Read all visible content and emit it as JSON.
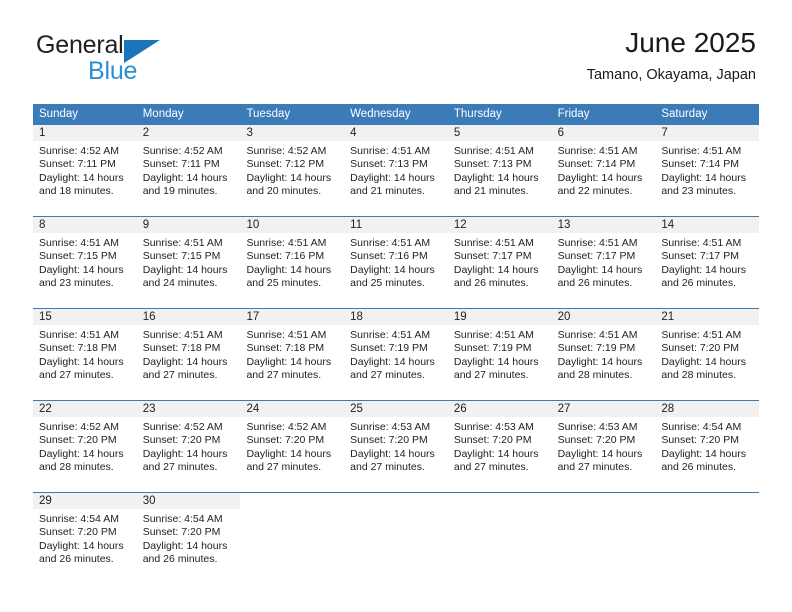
{
  "brand": {
    "name_top": "General",
    "name_bottom": "Blue",
    "accent_color": "#1b75bb",
    "accent_color_light": "#2b8fd4"
  },
  "header": {
    "title": "June 2025",
    "location": "Tamano, Okayama, Japan"
  },
  "theme": {
    "header_row_bg": "#3b7cb8",
    "day_number_bg": "#f1f1f1",
    "text_color": "#222222"
  },
  "calendar": {
    "weekdays": [
      "Sunday",
      "Monday",
      "Tuesday",
      "Wednesday",
      "Thursday",
      "Friday",
      "Saturday"
    ],
    "weeks": [
      [
        {
          "day": "1",
          "sunrise": "Sunrise: 4:52 AM",
          "sunset": "Sunset: 7:11 PM",
          "daylight_1": "Daylight: 14 hours",
          "daylight_2": "and 18 minutes."
        },
        {
          "day": "2",
          "sunrise": "Sunrise: 4:52 AM",
          "sunset": "Sunset: 7:11 PM",
          "daylight_1": "Daylight: 14 hours",
          "daylight_2": "and 19 minutes."
        },
        {
          "day": "3",
          "sunrise": "Sunrise: 4:52 AM",
          "sunset": "Sunset: 7:12 PM",
          "daylight_1": "Daylight: 14 hours",
          "daylight_2": "and 20 minutes."
        },
        {
          "day": "4",
          "sunrise": "Sunrise: 4:51 AM",
          "sunset": "Sunset: 7:13 PM",
          "daylight_1": "Daylight: 14 hours",
          "daylight_2": "and 21 minutes."
        },
        {
          "day": "5",
          "sunrise": "Sunrise: 4:51 AM",
          "sunset": "Sunset: 7:13 PM",
          "daylight_1": "Daylight: 14 hours",
          "daylight_2": "and 21 minutes."
        },
        {
          "day": "6",
          "sunrise": "Sunrise: 4:51 AM",
          "sunset": "Sunset: 7:14 PM",
          "daylight_1": "Daylight: 14 hours",
          "daylight_2": "and 22 minutes."
        },
        {
          "day": "7",
          "sunrise": "Sunrise: 4:51 AM",
          "sunset": "Sunset: 7:14 PM",
          "daylight_1": "Daylight: 14 hours",
          "daylight_2": "and 23 minutes."
        }
      ],
      [
        {
          "day": "8",
          "sunrise": "Sunrise: 4:51 AM",
          "sunset": "Sunset: 7:15 PM",
          "daylight_1": "Daylight: 14 hours",
          "daylight_2": "and 23 minutes."
        },
        {
          "day": "9",
          "sunrise": "Sunrise: 4:51 AM",
          "sunset": "Sunset: 7:15 PM",
          "daylight_1": "Daylight: 14 hours",
          "daylight_2": "and 24 minutes."
        },
        {
          "day": "10",
          "sunrise": "Sunrise: 4:51 AM",
          "sunset": "Sunset: 7:16 PM",
          "daylight_1": "Daylight: 14 hours",
          "daylight_2": "and 25 minutes."
        },
        {
          "day": "11",
          "sunrise": "Sunrise: 4:51 AM",
          "sunset": "Sunset: 7:16 PM",
          "daylight_1": "Daylight: 14 hours",
          "daylight_2": "and 25 minutes."
        },
        {
          "day": "12",
          "sunrise": "Sunrise: 4:51 AM",
          "sunset": "Sunset: 7:17 PM",
          "daylight_1": "Daylight: 14 hours",
          "daylight_2": "and 26 minutes."
        },
        {
          "day": "13",
          "sunrise": "Sunrise: 4:51 AM",
          "sunset": "Sunset: 7:17 PM",
          "daylight_1": "Daylight: 14 hours",
          "daylight_2": "and 26 minutes."
        },
        {
          "day": "14",
          "sunrise": "Sunrise: 4:51 AM",
          "sunset": "Sunset: 7:17 PM",
          "daylight_1": "Daylight: 14 hours",
          "daylight_2": "and 26 minutes."
        }
      ],
      [
        {
          "day": "15",
          "sunrise": "Sunrise: 4:51 AM",
          "sunset": "Sunset: 7:18 PM",
          "daylight_1": "Daylight: 14 hours",
          "daylight_2": "and 27 minutes."
        },
        {
          "day": "16",
          "sunrise": "Sunrise: 4:51 AM",
          "sunset": "Sunset: 7:18 PM",
          "daylight_1": "Daylight: 14 hours",
          "daylight_2": "and 27 minutes."
        },
        {
          "day": "17",
          "sunrise": "Sunrise: 4:51 AM",
          "sunset": "Sunset: 7:18 PM",
          "daylight_1": "Daylight: 14 hours",
          "daylight_2": "and 27 minutes."
        },
        {
          "day": "18",
          "sunrise": "Sunrise: 4:51 AM",
          "sunset": "Sunset: 7:19 PM",
          "daylight_1": "Daylight: 14 hours",
          "daylight_2": "and 27 minutes."
        },
        {
          "day": "19",
          "sunrise": "Sunrise: 4:51 AM",
          "sunset": "Sunset: 7:19 PM",
          "daylight_1": "Daylight: 14 hours",
          "daylight_2": "and 27 minutes."
        },
        {
          "day": "20",
          "sunrise": "Sunrise: 4:51 AM",
          "sunset": "Sunset: 7:19 PM",
          "daylight_1": "Daylight: 14 hours",
          "daylight_2": "and 28 minutes."
        },
        {
          "day": "21",
          "sunrise": "Sunrise: 4:51 AM",
          "sunset": "Sunset: 7:20 PM",
          "daylight_1": "Daylight: 14 hours",
          "daylight_2": "and 28 minutes."
        }
      ],
      [
        {
          "day": "22",
          "sunrise": "Sunrise: 4:52 AM",
          "sunset": "Sunset: 7:20 PM",
          "daylight_1": "Daylight: 14 hours",
          "daylight_2": "and 28 minutes."
        },
        {
          "day": "23",
          "sunrise": "Sunrise: 4:52 AM",
          "sunset": "Sunset: 7:20 PM",
          "daylight_1": "Daylight: 14 hours",
          "daylight_2": "and 27 minutes."
        },
        {
          "day": "24",
          "sunrise": "Sunrise: 4:52 AM",
          "sunset": "Sunset: 7:20 PM",
          "daylight_1": "Daylight: 14 hours",
          "daylight_2": "and 27 minutes."
        },
        {
          "day": "25",
          "sunrise": "Sunrise: 4:53 AM",
          "sunset": "Sunset: 7:20 PM",
          "daylight_1": "Daylight: 14 hours",
          "daylight_2": "and 27 minutes."
        },
        {
          "day": "26",
          "sunrise": "Sunrise: 4:53 AM",
          "sunset": "Sunset: 7:20 PM",
          "daylight_1": "Daylight: 14 hours",
          "daylight_2": "and 27 minutes."
        },
        {
          "day": "27",
          "sunrise": "Sunrise: 4:53 AM",
          "sunset": "Sunset: 7:20 PM",
          "daylight_1": "Daylight: 14 hours",
          "daylight_2": "and 27 minutes."
        },
        {
          "day": "28",
          "sunrise": "Sunrise: 4:54 AM",
          "sunset": "Sunset: 7:20 PM",
          "daylight_1": "Daylight: 14 hours",
          "daylight_2": "and 26 minutes."
        }
      ],
      [
        {
          "day": "29",
          "sunrise": "Sunrise: 4:54 AM",
          "sunset": "Sunset: 7:20 PM",
          "daylight_1": "Daylight: 14 hours",
          "daylight_2": "and 26 minutes."
        },
        {
          "day": "30",
          "sunrise": "Sunrise: 4:54 AM",
          "sunset": "Sunset: 7:20 PM",
          "daylight_1": "Daylight: 14 hours",
          "daylight_2": "and 26 minutes."
        },
        {
          "day": "",
          "sunrise": "",
          "sunset": "",
          "daylight_1": "",
          "daylight_2": ""
        },
        {
          "day": "",
          "sunrise": "",
          "sunset": "",
          "daylight_1": "",
          "daylight_2": ""
        },
        {
          "day": "",
          "sunrise": "",
          "sunset": "",
          "daylight_1": "",
          "daylight_2": ""
        },
        {
          "day": "",
          "sunrise": "",
          "sunset": "",
          "daylight_1": "",
          "daylight_2": ""
        },
        {
          "day": "",
          "sunrise": "",
          "sunset": "",
          "daylight_1": "",
          "daylight_2": ""
        }
      ]
    ]
  }
}
